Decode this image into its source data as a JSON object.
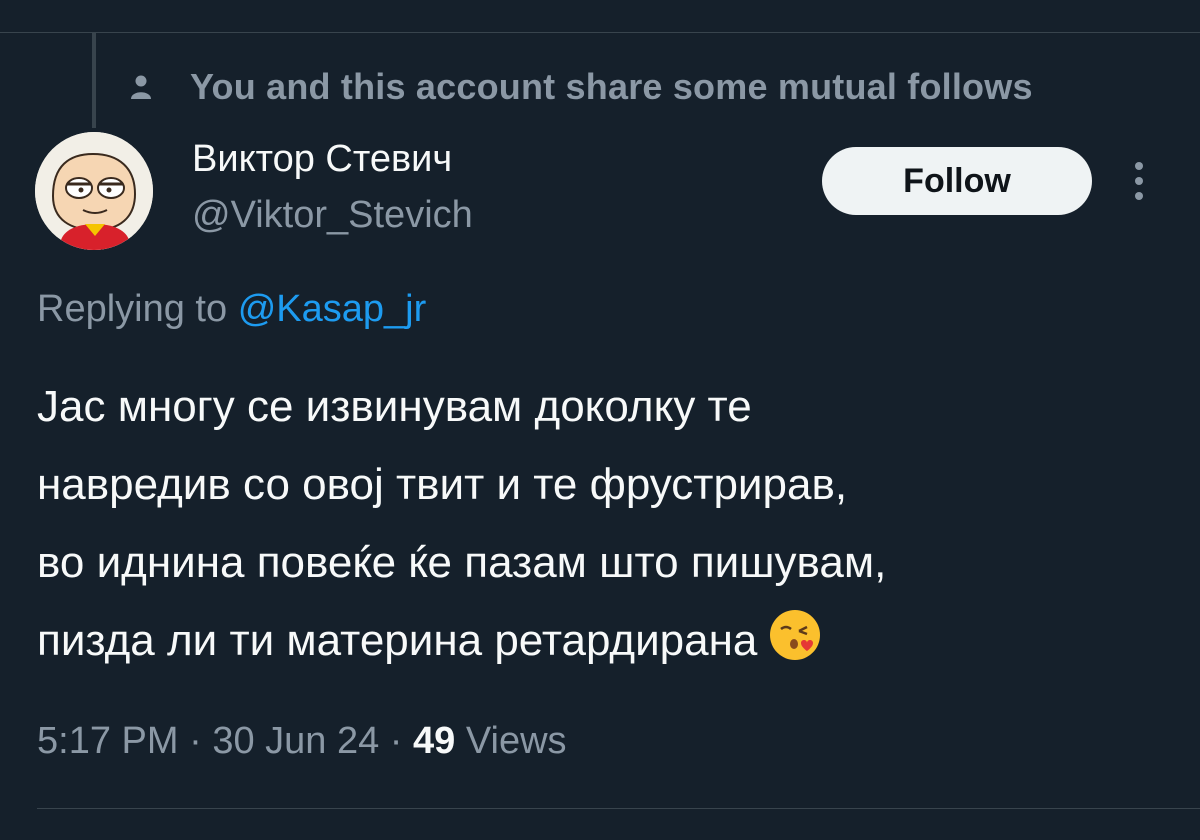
{
  "context": {
    "icon": "person-icon",
    "text": "You and this account share some mutual follows"
  },
  "author": {
    "display_name": "Виктор Стевич",
    "handle": "@Viktor_Stevich",
    "avatar": "cartoon-avatar"
  },
  "actions": {
    "follow_label": "Follow",
    "more_icon": "vertical-ellipsis-icon"
  },
  "reply": {
    "label": "Replying to",
    "mention": "@Kasap_jr"
  },
  "tweet": {
    "lines": [
      "Јас многу се извинувам доколку те",
      "навредив со овој твит и те фрустрирав,",
      "во иднина повеќе ќе пазам што пишувам,",
      "пизда ли ти материна ретардирана"
    ],
    "emoji": "kissing-face-emoji"
  },
  "meta": {
    "time": "5:17 PM",
    "separator": "·",
    "date": "30 Jun 24",
    "views_count": "49",
    "views_label": "Views"
  },
  "colors": {
    "background": "#15202b",
    "primary_text": "#f7f9f9",
    "secondary_text": "#8b98a5",
    "link": "#1d9bf0",
    "follow_button_bg": "#eff3f4"
  }
}
